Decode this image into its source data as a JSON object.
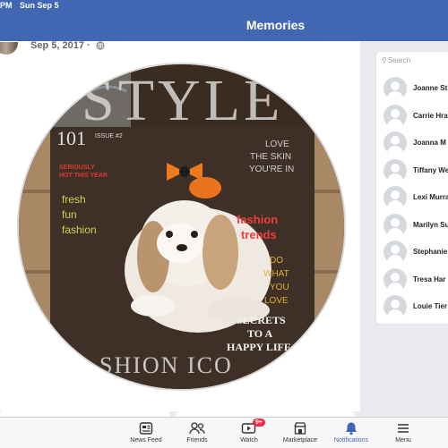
{
  "status_bar": {
    "time": "PM",
    "date": "Sun Sep 5"
  },
  "header": {
    "title": "Memories"
  },
  "post": {
    "date": "Sep 5, 2017 ·"
  },
  "photo": {
    "magazine_title": "STYLE",
    "issue_number": "101",
    "issue_sub": "ISSUE #2",
    "red_text": [
      "SERIOUSLY",
      "HOT THIS YEAR"
    ],
    "green_text": [
      "fresh",
      "fun",
      "fashion"
    ],
    "love_text": [
      "LOVE",
      "THE SKIN",
      "YOU'RE IN"
    ],
    "fashion_trends": [
      "fashion",
      "trends"
    ],
    "do_what": [
      "DO",
      "WHAT",
      "YOU",
      "LOVE"
    ],
    "secrets": [
      "SECRETS",
      "TO A",
      "HAPPY LIFE"
    ],
    "bottom_text": "SHION ICO"
  },
  "sidebar": {
    "search_placeholder": "Search",
    "contacts": [
      "Joanne St",
      "Carrie Hra",
      "Joanna M",
      "Tiffany We",
      "Lexi Murra",
      "Marilyn Su",
      "Stephanie",
      "Tresa Har",
      "Louie Tier"
    ]
  },
  "tabbar": {
    "tabs": [
      {
        "label": "News Feed",
        "icon": "news-feed-icon"
      },
      {
        "label": "Friends",
        "icon": "friends-icon"
      },
      {
        "label": "Watch",
        "icon": "watch-icon",
        "badge": "9+"
      },
      {
        "label": "Marketplace",
        "icon": "marketplace-icon"
      },
      {
        "label": "Notifications",
        "icon": "notifications-icon",
        "active": true
      },
      {
        "label": "Menu",
        "icon": "menu-icon"
      }
    ]
  },
  "colors": {
    "header": "#4267b2",
    "active": "#4267b2",
    "badge": "#f02849"
  }
}
